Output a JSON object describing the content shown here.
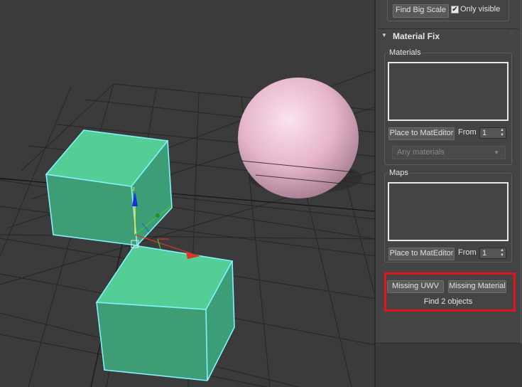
{
  "rollout_top": {
    "find_big_scale_label": "Find Big Scale",
    "only_visible_label": "Only visible",
    "only_visible_checked": true
  },
  "material_fix": {
    "title": "Material Fix",
    "collapse_icon": "triangle-down-icon",
    "drag_handle_icon": "grip-dots-icon",
    "materials": {
      "group_label": "Materials",
      "place_button": "Place to MatEditor",
      "from_label": "From",
      "from_value": "1",
      "dropdown_value": "Any materials"
    },
    "maps": {
      "group_label": "Maps",
      "place_button": "Place to MatEditor",
      "from_label": "From",
      "from_value": "1"
    },
    "missing_uwv_button": "Missing UWV",
    "missing_material_button": "Missing Material",
    "status_text": "Find 2 objects"
  },
  "colors": {
    "panel_bg": "#444444",
    "viewport_bg": "#3b3b3b",
    "highlight": "#e3141b",
    "box_face": "#52c794",
    "box_selection": "#7ff4ff",
    "sphere": "#e8b9cf"
  }
}
